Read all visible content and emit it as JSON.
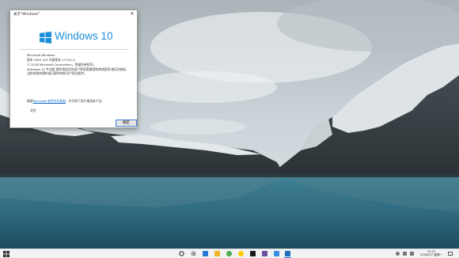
{
  "dialog": {
    "title": "关于\"Windows\"",
    "close_glyph": "✕",
    "logo_text": "Windows 10",
    "lines": [
      "Microsoft Windows",
      "版本 1803 (OS 内部版本 17134.1)",
      "© 2018 Microsoft Corporation。保留所有权利。",
      "Windows 10 专业版 操作系统及其用户界面受美国和其他国家/地区的商标法和其他待颁布或已颁布的知识产权法保护。"
    ],
    "license_prefix": "根据",
    "license_link": "Microsoft 软件许可条款",
    "license_suffix": "，许可如下用户使用本产品:",
    "licensee": "北京",
    "ok_label": "确定"
  },
  "taskbar": {
    "time": "15:07",
    "date": "2018/5/7 星期一"
  },
  "colors": {
    "accent": "#1e8fd8",
    "taskbar": "#f1f2f2"
  }
}
